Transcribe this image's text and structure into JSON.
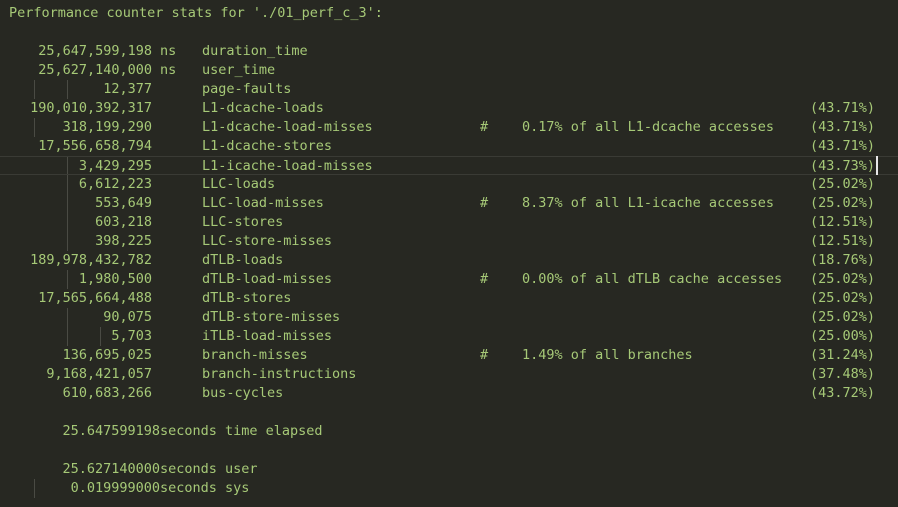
{
  "header": "Performance counter stats for './01_perf_c_3':",
  "rows": [
    {
      "count": "25,647,599,198",
      "unit": "ns",
      "event": "duration_time",
      "hash": "",
      "comment": "",
      "pct": ""
    },
    {
      "count": "25,627,140,000",
      "unit": "ns",
      "event": "user_time",
      "hash": "",
      "comment": "",
      "pct": ""
    },
    {
      "count": "12,377",
      "unit": "",
      "event": "page-faults",
      "hash": "",
      "comment": "",
      "pct": ""
    },
    {
      "count": "190,010,392,317",
      "unit": "",
      "event": "L1-dcache-loads",
      "hash": "",
      "comment": "",
      "pct": "(43.71%)"
    },
    {
      "count": "318,199,290",
      "unit": "",
      "event": "L1-dcache-load-misses",
      "hash": "#",
      "comment": "0.17% of all L1-dcache accesses",
      "pct": "(43.71%)"
    },
    {
      "count": "17,556,658,794",
      "unit": "",
      "event": "L1-dcache-stores",
      "hash": "",
      "comment": "",
      "pct": "(43.71%)"
    },
    {
      "count": "3,429,295",
      "unit": "",
      "event": "L1-icache-load-misses",
      "hash": "",
      "comment": "",
      "pct": "(43.73%)"
    },
    {
      "count": "6,612,223",
      "unit": "",
      "event": "LLC-loads",
      "hash": "",
      "comment": "",
      "pct": "(25.02%)"
    },
    {
      "count": "553,649",
      "unit": "",
      "event": "LLC-load-misses",
      "hash": "#",
      "comment": "8.37% of all L1-icache accesses",
      "pct": "(25.02%)"
    },
    {
      "count": "603,218",
      "unit": "",
      "event": "LLC-stores",
      "hash": "",
      "comment": "",
      "pct": "(12.51%)"
    },
    {
      "count": "398,225",
      "unit": "",
      "event": "LLC-store-misses",
      "hash": "",
      "comment": "",
      "pct": "(12.51%)"
    },
    {
      "count": "189,978,432,782",
      "unit": "",
      "event": "dTLB-loads",
      "hash": "",
      "comment": "",
      "pct": "(18.76%)"
    },
    {
      "count": "1,980,500",
      "unit": "",
      "event": "dTLB-load-misses",
      "hash": "#",
      "comment": "0.00% of all dTLB cache accesses",
      "pct": "(25.02%)"
    },
    {
      "count": "17,565,664,488",
      "unit": "",
      "event": "dTLB-stores",
      "hash": "",
      "comment": "",
      "pct": "(25.02%)"
    },
    {
      "count": "90,075",
      "unit": "",
      "event": "dTLB-store-misses",
      "hash": "",
      "comment": "",
      "pct": "(25.02%)"
    },
    {
      "count": "5,703",
      "unit": "",
      "event": "iTLB-load-misses",
      "hash": "",
      "comment": "",
      "pct": "(25.00%)"
    },
    {
      "count": "136,695,025",
      "unit": "",
      "event": "branch-misses",
      "hash": "#",
      "comment": "1.49% of all branches",
      "pct": "(31.24%)"
    },
    {
      "count": "9,168,421,057",
      "unit": "",
      "event": "branch-instructions",
      "hash": "",
      "comment": "",
      "pct": "(37.48%)"
    },
    {
      "count": "610,683,266",
      "unit": "",
      "event": "bus-cycles",
      "hash": "",
      "comment": "",
      "pct": "(43.72%)"
    }
  ],
  "summary": {
    "elapsed_value": "25.647599198",
    "elapsed_label": "seconds time elapsed",
    "user_value": "25.627140000",
    "user_label": "seconds user",
    "sys_value": "0.019999000",
    "sys_label": "seconds sys"
  }
}
